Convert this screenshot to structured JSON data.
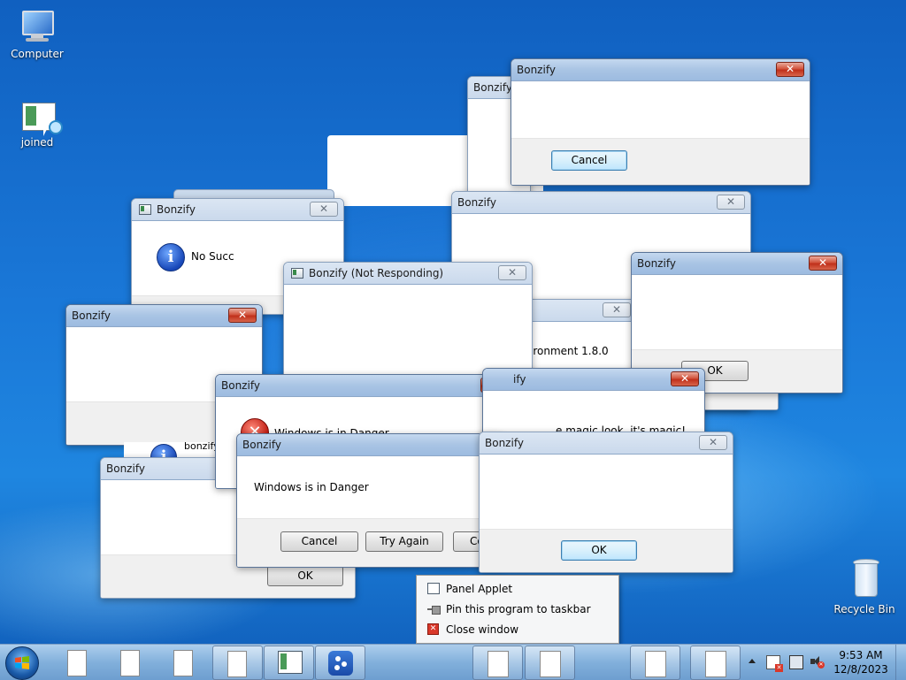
{
  "desktop": {
    "icons": [
      {
        "label": "Computer",
        "icon": "computer-icon"
      },
      {
        "label": "joined",
        "icon": "application-icon"
      },
      {
        "label": "Recycle Bin",
        "icon": "recycle-bin-icon"
      }
    ]
  },
  "windows": {
    "w_top_right": {
      "title": "Bonzify",
      "button": "Cancel"
    },
    "w_behind_top": {
      "title": "Bonzify"
    },
    "w_info": {
      "title": "Bonzify",
      "message": "No Succ"
    },
    "w_mid_right": {
      "title": "Bonzify"
    },
    "w_not_responding": {
      "title": "Bonzify (Not Responding)"
    },
    "w_env": {
      "message": "ironment 1.8.0"
    },
    "w_right": {
      "title": "Bonzify",
      "button": "OK"
    },
    "w_left": {
      "title": "Bonzify"
    },
    "w_danger_back": {
      "title": "Bonzify",
      "message": "Windows is in Danger"
    },
    "w_magic": {
      "title": "ify",
      "message": "e magic look, it's magic!"
    },
    "w_partial_label": {
      "message": "bonzify"
    },
    "w_bottom_left": {
      "title": "Bonzify",
      "button": "OK"
    },
    "w_danger": {
      "title": "Bonzify",
      "message": "Windows is in Danger",
      "buttons": [
        "Cancel",
        "Try Again",
        "Co"
      ]
    },
    "w_ok": {
      "title": "Bonzify",
      "button": "OK"
    }
  },
  "context_menu": {
    "items": [
      {
        "label": "Panel Applet",
        "icon": "applet-icon"
      },
      {
        "label": "Pin this program to taskbar",
        "icon": "pin-icon"
      },
      {
        "label": "Close window",
        "icon": "close-window-icon"
      }
    ]
  },
  "taskbar": {
    "start_icon": "windows-start-icon",
    "clock_time": "9:53 AM",
    "clock_date": "12/8/2023",
    "tray_icons": [
      "show-hidden-icons-icon",
      "action-center-icon",
      "network-icon",
      "volume-muted-icon"
    ]
  },
  "colors": {
    "close_red": "#c0301b",
    "titlebar": "#a9c4e4",
    "desktop_blue": "#1a78d8"
  }
}
